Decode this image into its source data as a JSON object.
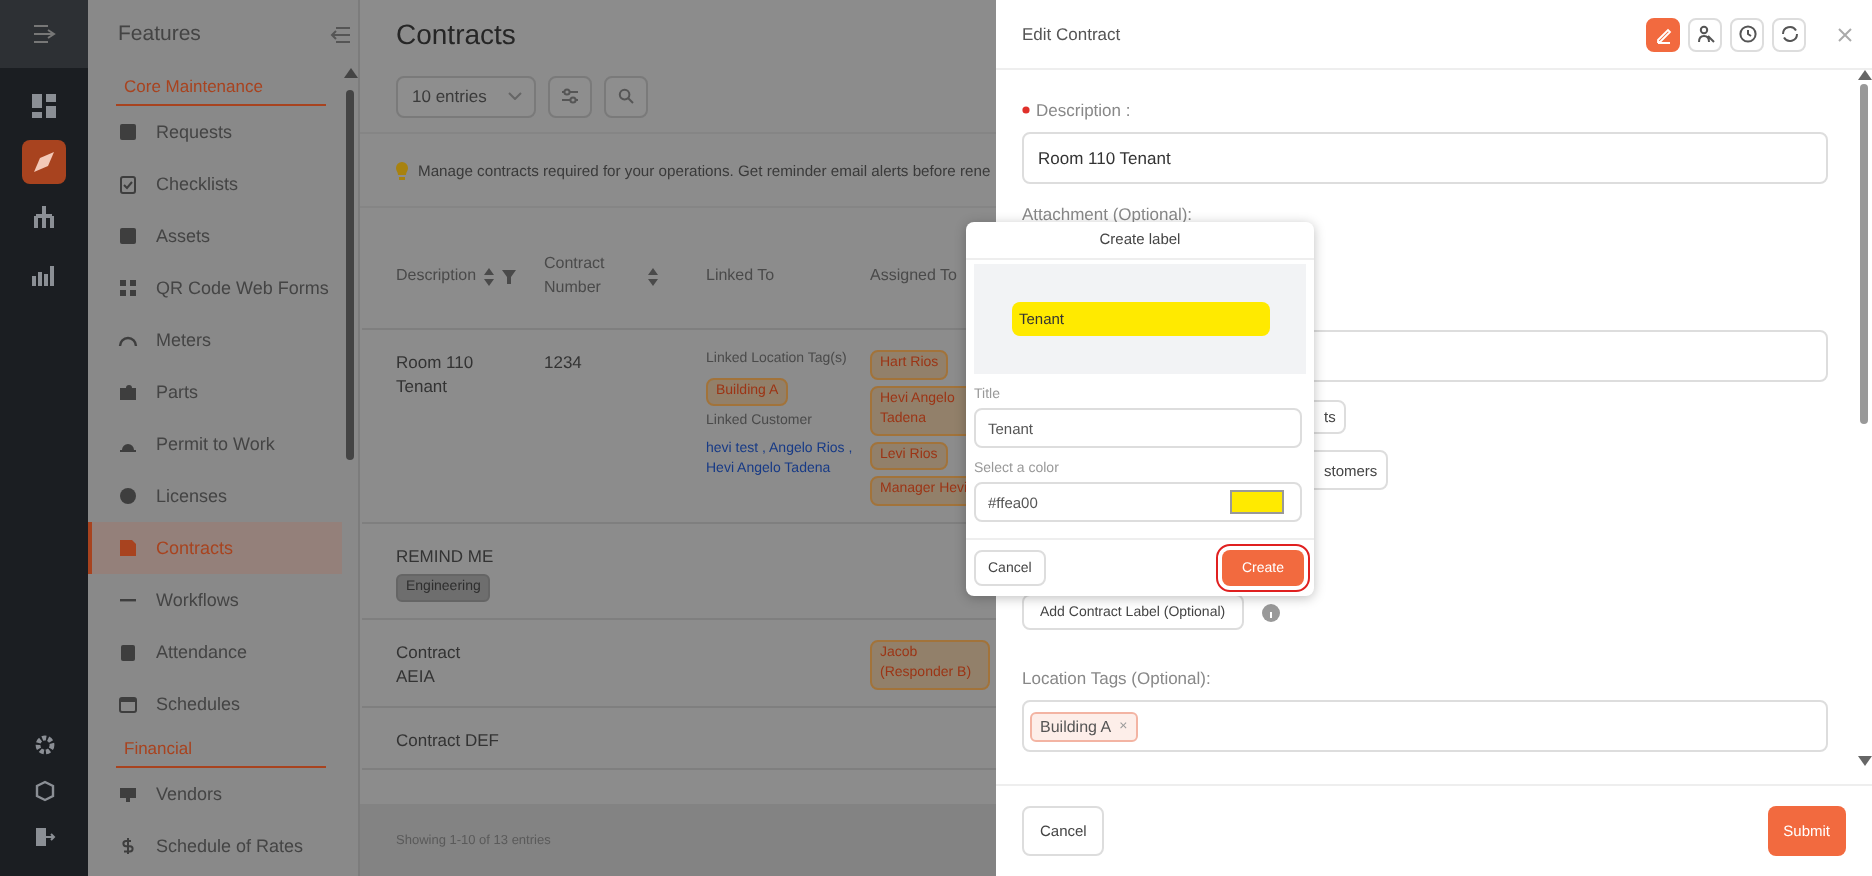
{
  "rail": [
    {
      "selected": false
    },
    {
      "selected": true
    },
    {
      "selected": false
    },
    {
      "selected": false
    }
  ],
  "sidebar": {
    "title": "Features",
    "sections": [
      {
        "title": "Core Maintenance",
        "items": [
          {
            "label": "Requests",
            "selected": false
          },
          {
            "label": "Checklists",
            "selected": false
          },
          {
            "label": "Assets",
            "selected": false
          },
          {
            "label": "QR Code Web Forms",
            "selected": false
          },
          {
            "label": "Meters",
            "selected": false
          },
          {
            "label": "Parts",
            "selected": false
          },
          {
            "label": "Permit to Work",
            "selected": false
          },
          {
            "label": "Licenses",
            "selected": false
          },
          {
            "label": "Contracts",
            "selected": true
          },
          {
            "label": "Workflows",
            "selected": false
          },
          {
            "label": "Attendance",
            "selected": false
          },
          {
            "label": "Schedules",
            "selected": false
          }
        ]
      },
      {
        "title": "Financial",
        "items": [
          {
            "label": "Vendors",
            "selected": false
          },
          {
            "label": "Schedule of Rates",
            "selected": false
          }
        ]
      }
    ]
  },
  "main": {
    "title": "Contracts",
    "entries_select": "10 entries",
    "notice": "Manage contracts required for your operations. Get reminder email alerts before rene",
    "table": {
      "columns": [
        {
          "label": "Description",
          "sortable": true,
          "filter": true
        },
        {
          "label": "Contract Number",
          "sortable": true,
          "filter": false
        },
        {
          "label": "Linked To",
          "sortable": false,
          "filter": false
        },
        {
          "label": "Assigned To",
          "sortable": false,
          "filter": false
        }
      ],
      "rows": [
        {
          "description": "Room 110 Tenant",
          "contract_number": "1234",
          "linked": [
            {
              "kind": "heading",
              "text": "Linked Location Tag(s)"
            },
            {
              "kind": "tag",
              "text": "Building A"
            },
            {
              "kind": "heading",
              "text": "Linked Customer"
            },
            {
              "kind": "link",
              "text": "hevi test , Angelo Rios , Hevi Angelo Tadena"
            }
          ],
          "assigned": [
            "Hart Rios",
            "Hevi Angelo Tadena",
            "Levi Rios",
            "Manager Hevi"
          ]
        },
        {
          "description": "REMIND ME",
          "labels": [
            "Engineering"
          ]
        },
        {
          "description": "Contract AEIA",
          "assigned": [
            "Jacob (Responder B)"
          ]
        },
        {
          "description": "Contract DEF"
        }
      ]
    },
    "footer": "Showing 1-10 of 13 entries"
  },
  "drawer": {
    "title": "Edit Contract",
    "tools": [
      {
        "selected": true
      },
      {
        "selected": false
      },
      {
        "selected": false
      },
      {
        "selected": false
      }
    ],
    "description": {
      "label": "Description :",
      "required": true,
      "value": "Room 110 Tenant"
    },
    "attachment_label": "Attachment (Optional):",
    "partial_buttons": [
      "ts",
      "stomers"
    ],
    "add_label_button": "Add Contract Label (Optional)",
    "location_tags": {
      "label": "Location Tags (Optional):",
      "tags": [
        {
          "text": "Building A",
          "remove": "×"
        }
      ]
    },
    "cancel": "Cancel",
    "submit": "Submit"
  },
  "popover": {
    "title": "Create label",
    "preview": {
      "text": "Tenant",
      "color": "#ffea00"
    },
    "title_field": {
      "label": "Title",
      "value": "Tenant"
    },
    "color_field": {
      "label": "Select a color",
      "value": "#ffea00",
      "color": "#ffea00"
    },
    "cancel": "Cancel",
    "create": "Create",
    "create_focused": true
  }
}
